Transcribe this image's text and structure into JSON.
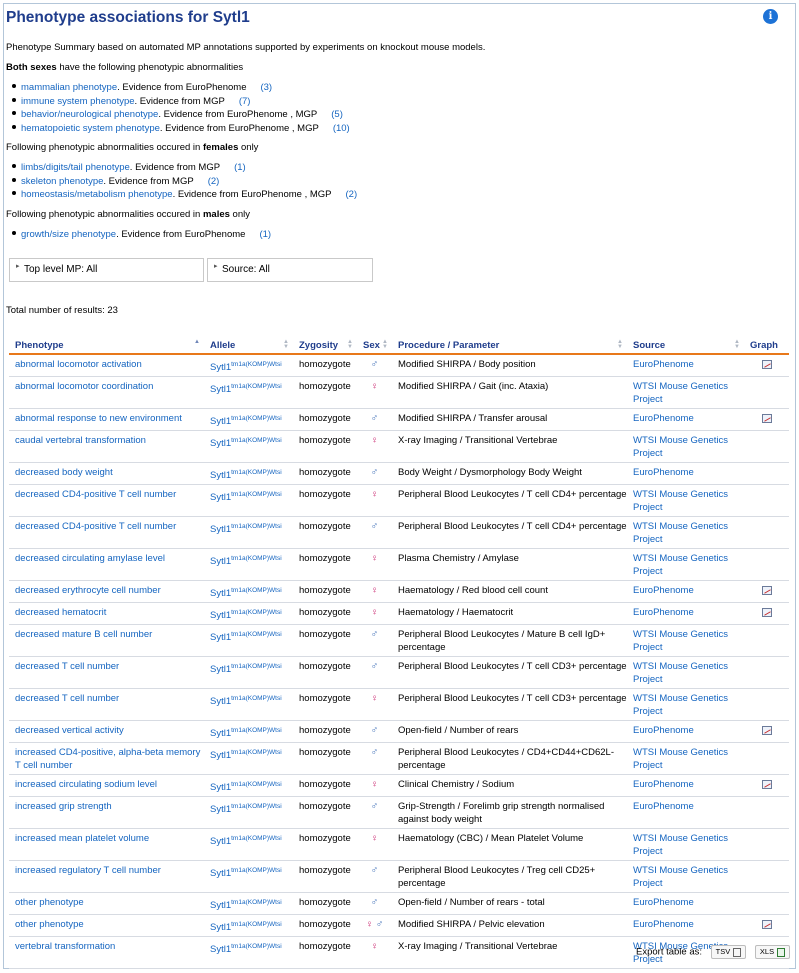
{
  "title": "Phenotype associations for Sytl1",
  "info_icon": "i",
  "summary": "Phenotype Summary based on automated MP annotations supported by experiments on knockout mouse models.",
  "both": {
    "lead_bold": "Both sexes",
    "lead_rest": " have the following phenotypic abnormalities",
    "items": [
      {
        "link": "mammalian phenotype",
        "evidence": ". Evidence from EuroPhenome",
        "count": "(3)"
      },
      {
        "link": "immune system phenotype",
        "evidence": ". Evidence from MGP",
        "count": "(7)"
      },
      {
        "link": "behavior/neurological phenotype",
        "evidence": ". Evidence from EuroPhenome ,  MGP",
        "count": "(5)"
      },
      {
        "link": "hematopoietic system phenotype",
        "evidence": ". Evidence from EuroPhenome ,  MGP",
        "count": "(10)"
      }
    ]
  },
  "females": {
    "lead_pre": "Following phenotypic abnormalities occured in ",
    "lead_bold": "females",
    "lead_post": " only",
    "items": [
      {
        "link": "limbs/digits/tail phenotype",
        "evidence": ". Evidence from MGP",
        "count": "(1)"
      },
      {
        "link": "skeleton phenotype",
        "evidence": ". Evidence from MGP",
        "count": "(2)"
      },
      {
        "link": "homeostasis/metabolism phenotype",
        "evidence": ". Evidence from EuroPhenome ,  MGP",
        "count": "(2)"
      }
    ]
  },
  "males": {
    "lead_pre": "Following phenotypic abnormalities occured in ",
    "lead_bold": "males",
    "lead_post": " only",
    "items": [
      {
        "link": "growth/size phenotype",
        "evidence": ". Evidence from EuroPhenome",
        "count": "(1)"
      }
    ]
  },
  "filters": {
    "top_level": "Top level MP: All",
    "source": "Source: All"
  },
  "total": "Total number of results: 23",
  "table": {
    "headers": [
      "Phenotype",
      "Allele",
      "Zygosity",
      "Sex",
      "Procedure / Parameter",
      "Source",
      "Graph"
    ],
    "allele_base": "Sytl1",
    "allele_sup": "tm1a(KOMP)Wtsi",
    "rows": [
      {
        "phenotype": "abnormal locomotor activation",
        "zygosity": "homozygote",
        "sex": "male",
        "procedure": "Modified SHIRPA / Body position",
        "source": "EuroPhenome",
        "graph": true
      },
      {
        "phenotype": "abnormal locomotor coordination",
        "zygosity": "homozygote",
        "sex": "female",
        "procedure": "Modified SHIRPA / Gait (inc. Ataxia)",
        "source": "WTSI Mouse Genetics Project",
        "graph": false
      },
      {
        "phenotype": "abnormal response to new environment",
        "zygosity": "homozygote",
        "sex": "male",
        "procedure": "Modified SHIRPA / Transfer arousal",
        "source": "EuroPhenome",
        "graph": true
      },
      {
        "phenotype": "caudal vertebral transformation",
        "zygosity": "homozygote",
        "sex": "female",
        "procedure": "X-ray Imaging / Transitional Vertebrae",
        "source": "WTSI Mouse Genetics Project",
        "graph": false
      },
      {
        "phenotype": "decreased body weight",
        "zygosity": "homozygote",
        "sex": "male",
        "procedure": "Body Weight / Dysmorphology Body Weight",
        "source": "EuroPhenome",
        "graph": false
      },
      {
        "phenotype": "decreased CD4-positive T cell number",
        "zygosity": "homozygote",
        "sex": "female",
        "procedure": "Peripheral Blood Leukocytes / T cell CD4+ percentage",
        "source": "WTSI Mouse Genetics Project",
        "graph": false
      },
      {
        "phenotype": "decreased CD4-positive T cell number",
        "zygosity": "homozygote",
        "sex": "male",
        "procedure": "Peripheral Blood Leukocytes / T cell CD4+ percentage",
        "source": "WTSI Mouse Genetics Project",
        "graph": false
      },
      {
        "phenotype": "decreased circulating amylase level",
        "zygosity": "homozygote",
        "sex": "female",
        "procedure": "Plasma Chemistry / Amylase",
        "source": "WTSI Mouse Genetics Project",
        "graph": false
      },
      {
        "phenotype": "decreased erythrocyte cell number",
        "zygosity": "homozygote",
        "sex": "female",
        "procedure": "Haematology / Red blood cell count",
        "source": "EuroPhenome",
        "graph": true
      },
      {
        "phenotype": "decreased hematocrit",
        "zygosity": "homozygote",
        "sex": "female",
        "procedure": "Haematology / Haematocrit",
        "source": "EuroPhenome",
        "graph": true
      },
      {
        "phenotype": "decreased mature B cell number",
        "zygosity": "homozygote",
        "sex": "male",
        "procedure": "Peripheral Blood Leukocytes / Mature B cell IgD+ percentage",
        "source": "WTSI Mouse Genetics Project",
        "graph": false
      },
      {
        "phenotype": "decreased T cell number",
        "zygosity": "homozygote",
        "sex": "male",
        "procedure": "Peripheral Blood Leukocytes / T cell CD3+ percentage",
        "source": "WTSI Mouse Genetics Project",
        "graph": false
      },
      {
        "phenotype": "decreased T cell number",
        "zygosity": "homozygote",
        "sex": "female",
        "procedure": "Peripheral Blood Leukocytes / T cell CD3+ percentage",
        "source": "WTSI Mouse Genetics Project",
        "graph": false
      },
      {
        "phenotype": "decreased vertical activity",
        "zygosity": "homozygote",
        "sex": "male",
        "procedure": "Open-field / Number of rears",
        "source": "EuroPhenome",
        "graph": true
      },
      {
        "phenotype": "increased CD4-positive, alpha-beta memory T cell number",
        "zygosity": "homozygote",
        "sex": "male",
        "procedure": "Peripheral Blood Leukocytes / CD4+CD44+CD62L- percentage",
        "source": "WTSI Mouse Genetics Project",
        "graph": false
      },
      {
        "phenotype": "increased circulating sodium level",
        "zygosity": "homozygote",
        "sex": "female",
        "procedure": "Clinical Chemistry / Sodium",
        "source": "EuroPhenome",
        "graph": true
      },
      {
        "phenotype": "increased grip strength",
        "zygosity": "homozygote",
        "sex": "male",
        "procedure": "Grip-Strength / Forelimb grip strength normalised against body weight",
        "source": "EuroPhenome",
        "graph": false
      },
      {
        "phenotype": "increased mean platelet volume",
        "zygosity": "homozygote",
        "sex": "female",
        "procedure": "Haematology (CBC) / Mean Platelet Volume",
        "source": "WTSI Mouse Genetics Project",
        "graph": false
      },
      {
        "phenotype": "increased regulatory T cell number",
        "zygosity": "homozygote",
        "sex": "male",
        "procedure": "Peripheral Blood Leukocytes / Treg cell CD25+ percentage",
        "source": "WTSI Mouse Genetics Project",
        "graph": false
      },
      {
        "phenotype": "other phenotype",
        "zygosity": "homozygote",
        "sex": "male",
        "procedure": "Open-field / Number of rears - total",
        "source": "EuroPhenome",
        "graph": false
      },
      {
        "phenotype": "other phenotype",
        "zygosity": "homozygote",
        "sex": "both",
        "procedure": "Modified SHIRPA / Pelvic elevation",
        "source": "EuroPhenome",
        "graph": true
      },
      {
        "phenotype": "vertebral transformation",
        "zygosity": "homozygote",
        "sex": "female",
        "procedure": "X-ray Imaging / Transitional Vertebrae",
        "source": "WTSI Mouse Genetics Project",
        "graph": false
      }
    ]
  },
  "export": {
    "label": "Export table as:",
    "tsv": "TSV",
    "xls": "XLS"
  },
  "colors": {
    "title": "#1f3d8c",
    "link": "#1565c0",
    "header_rule": "#e8781a",
    "male": "#3a6bb5",
    "female": "#cc3377"
  }
}
